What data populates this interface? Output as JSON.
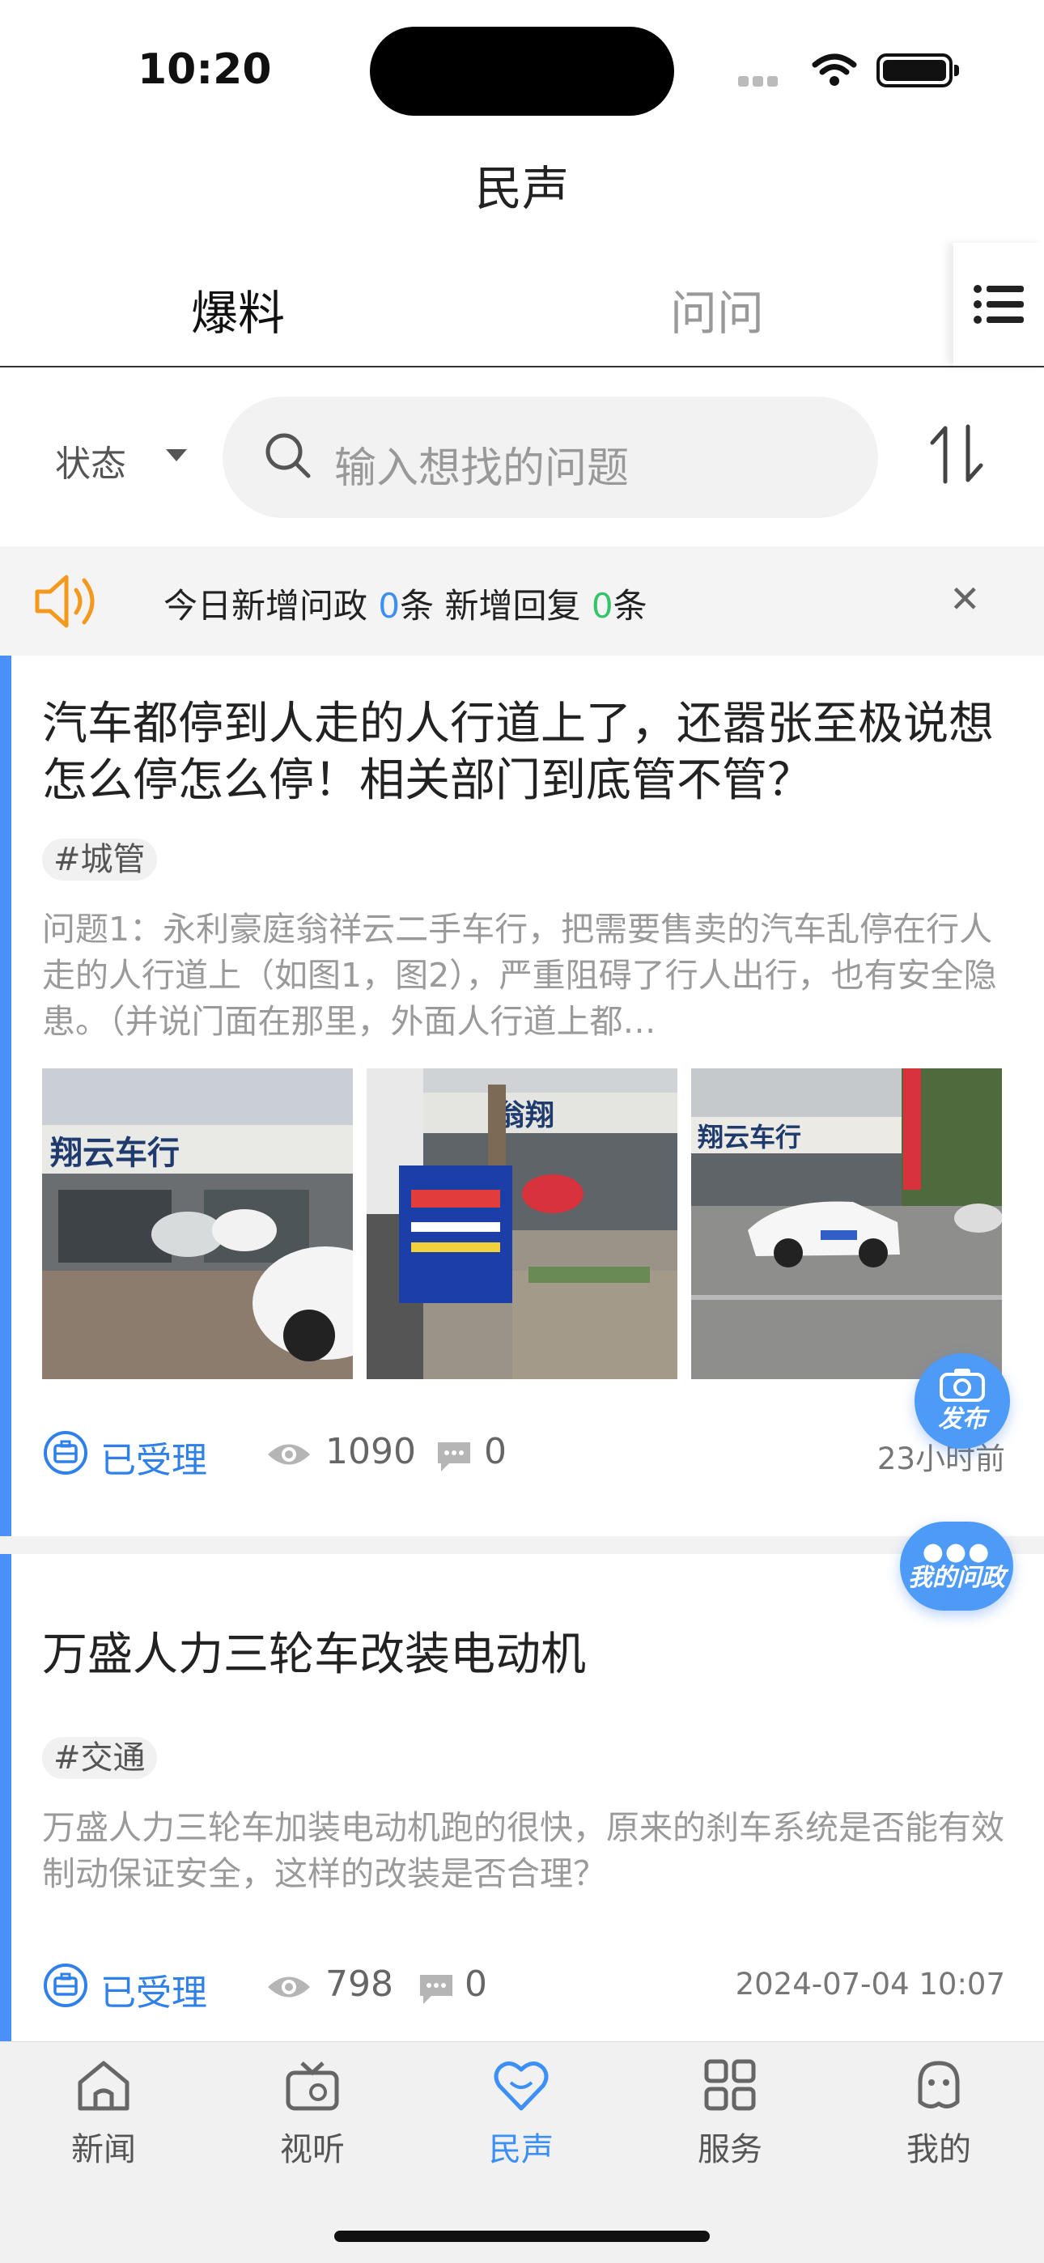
{
  "status_bar": {
    "time": "10:20"
  },
  "header": {
    "title": "民声"
  },
  "tabs": [
    {
      "label": "爆料"
    },
    {
      "label": "问问"
    }
  ],
  "filter": {
    "status_label": "状态",
    "search_placeholder": "输入想找的问题"
  },
  "notice": {
    "prefix": "今日新增问政",
    "new_questions": "0",
    "mid": "条 新增回复",
    "new_replies": "0",
    "suffix": "条"
  },
  "posts": [
    {
      "title": "汽车都停到人走的人行道上了，还嚣张至极说想怎么停怎么停！相关部门到底管不管？",
      "tag": "#城管",
      "desc": "问题1：永利豪庭翁祥云二手车行，把需要售卖的汽车乱停在行人走的人行道上（如图1，图2），严重阻碍了行人出行，也有安全隐患。（并说门面在那里，外面人行道上都…",
      "status": "已受理",
      "views": "1090",
      "comments": "0",
      "time": "23小时前"
    },
    {
      "title": "万盛人力三轮车改装电动机",
      "tag": "#交通",
      "desc": "万盛人力三轮车加装电动机跑的很快，原来的刹车系统是否能有效制动保证安全，这样的改装是否合理？",
      "status": "已受理",
      "views": "798",
      "comments": "0",
      "time": "2024-07-04 10:07"
    }
  ],
  "fabs": {
    "publish": "发布",
    "my_questions": "我的问政"
  },
  "bottom_nav": [
    {
      "label": "新闻"
    },
    {
      "label": "视听"
    },
    {
      "label": "民声"
    },
    {
      "label": "服务"
    },
    {
      "label": "我的"
    }
  ],
  "colors": {
    "accent": "#3b8ff5",
    "card_bar": "#4a90f7",
    "reply_count": "#35c46a"
  }
}
